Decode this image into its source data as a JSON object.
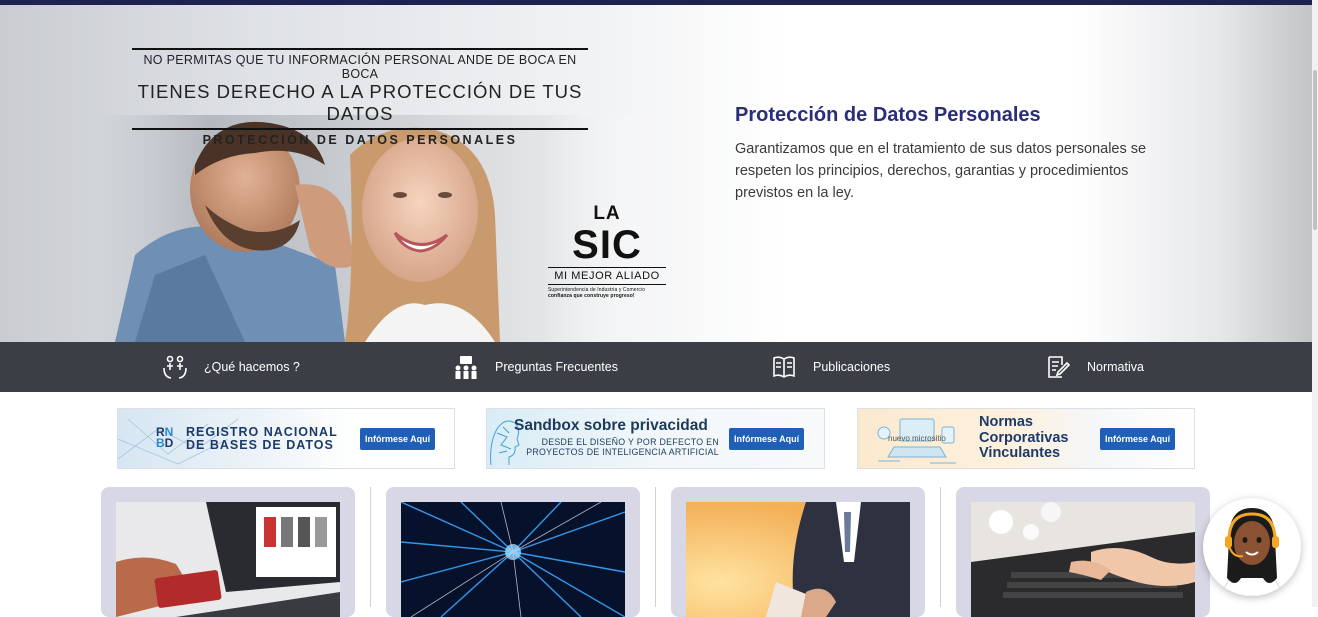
{
  "hero": {
    "tagline_1": "NO PERMITAS QUE TU INFORMACIÓN PERSONAL ANDE DE BOCA EN BOCA",
    "tagline_2": "TIENES DERECHO A LA PROTECCIÓN DE TUS DATOS",
    "tagline_3": "PROTECCIÓN DE DATOS PERSONALES",
    "logo_la": "LA",
    "logo_sic": "SIC",
    "logo_aliado": "MI MEJOR ALIADO",
    "logo_small_1": "Superintendencia de Industria y Comercio",
    "logo_small_2": "confianza que construye progreso!",
    "title": "Protección de Datos Personales",
    "description": "Garantizamos que en el tratamiento de sus datos personales se respeten los principios, derechos, garantias y procedimientos previstos en la  ley."
  },
  "nav": {
    "items": [
      {
        "label": "¿Qué hacemos ?",
        "icon": "hands-people-icon"
      },
      {
        "label": "Preguntas Frecuentes",
        "icon": "people-board-icon"
      },
      {
        "label": "Publicaciones",
        "icon": "book-icon"
      },
      {
        "label": "Normativa",
        "icon": "document-edit-icon"
      }
    ]
  },
  "banners": {
    "rnbd": {
      "logo_r": "R",
      "logo_n": "N",
      "logo_b": "B",
      "logo_d": "D",
      "line1": "REGISTRO NACIONAL",
      "line2": "DE BASES DE DATOS",
      "button": "Infórmese Aquí"
    },
    "sandbox": {
      "title": "Sandbox sobre privacidad",
      "line1": "DESDE EL DISEÑO Y POR DEFECTO EN",
      "line2": "PROYECTOS DE INTELIGENCIA ARTIFICIAL",
      "button": "Infórmese Aquí"
    },
    "normas": {
      "micro": "nuevo micrositio",
      "line1": "Normas",
      "line2": "Corporativas",
      "line3": "Vinculantes",
      "button": "Infórmese Aquí"
    }
  },
  "colors": {
    "accent": "#2b2c7c",
    "navbar": "#3b3e45",
    "button": "#1f5fb8",
    "card_bg": "#d7d7e6"
  }
}
